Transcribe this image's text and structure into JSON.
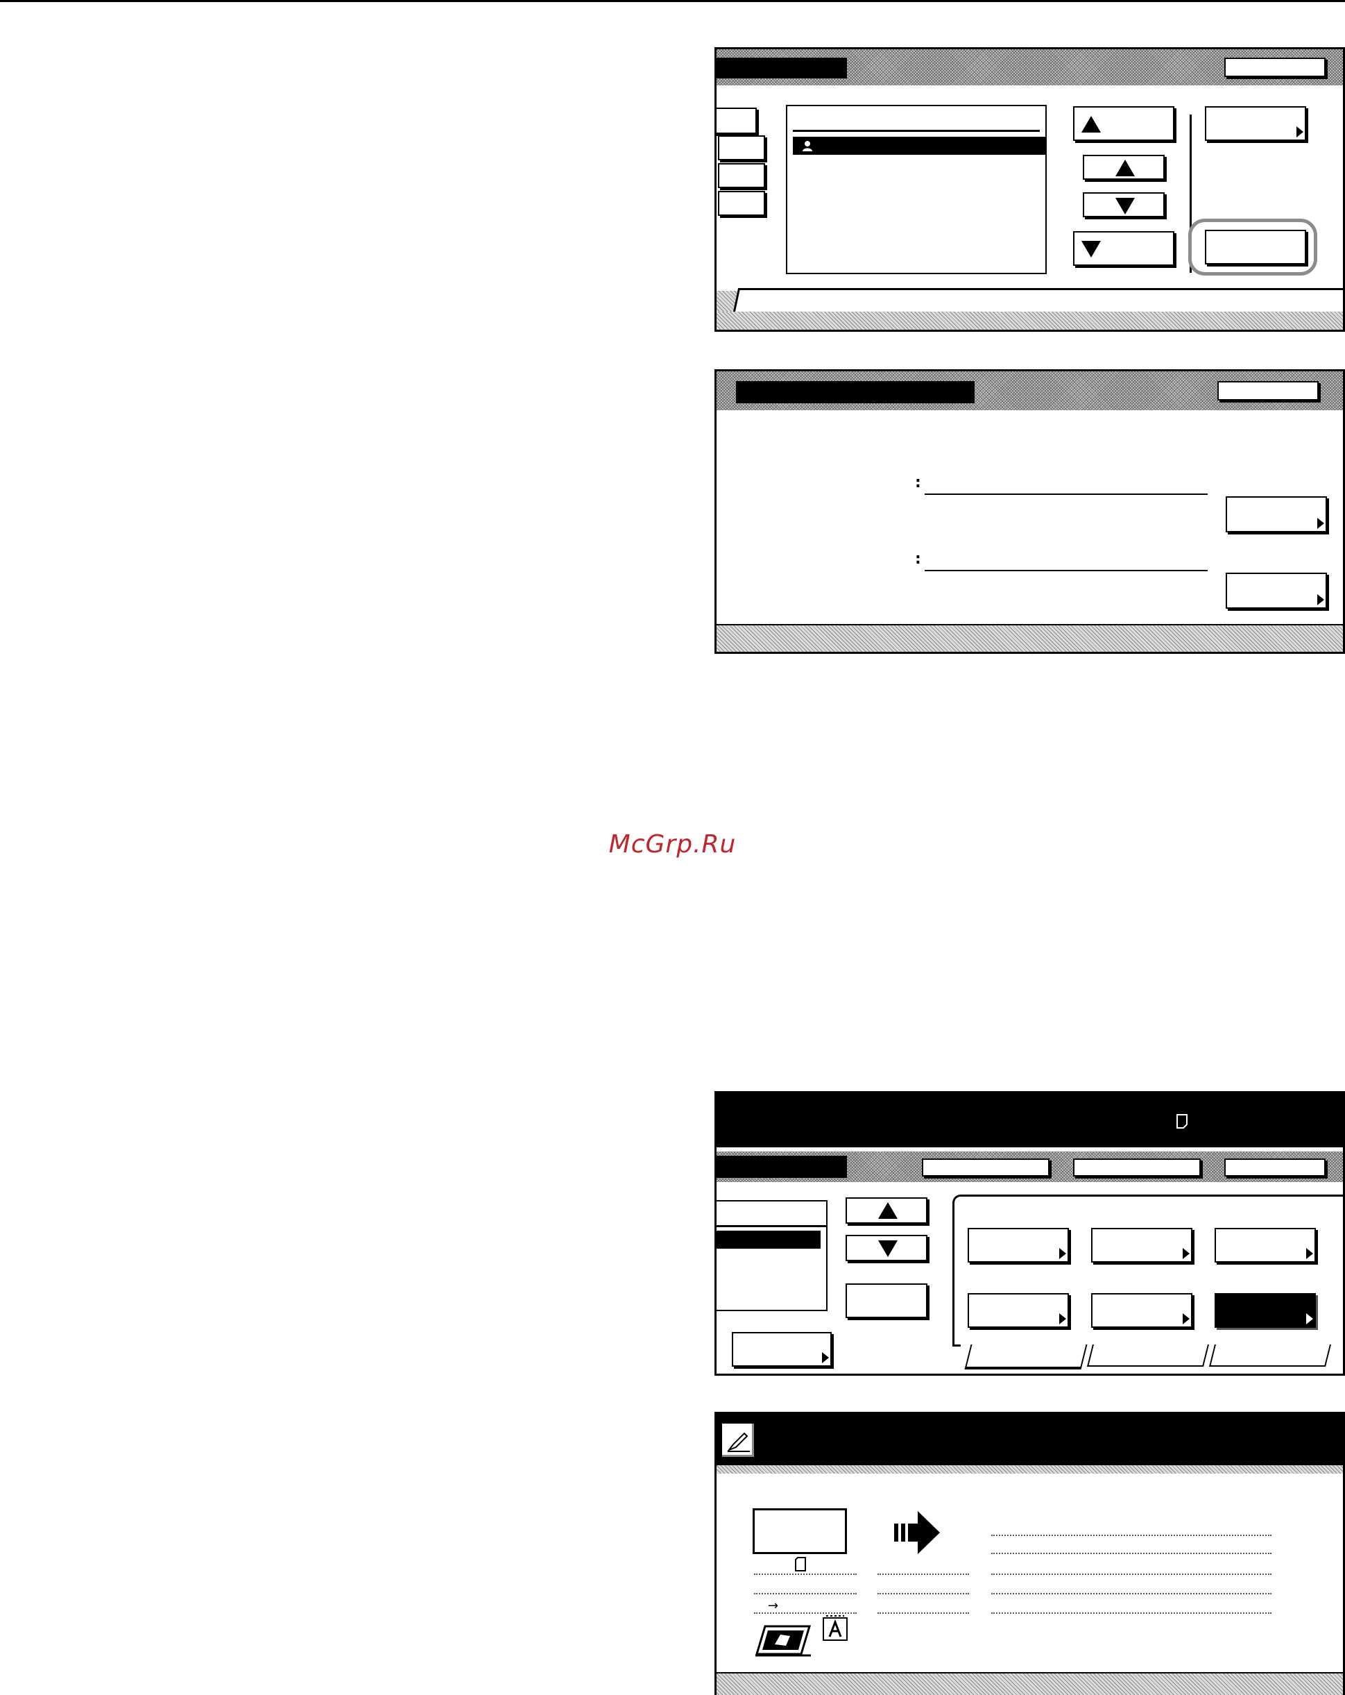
{
  "watermark": {
    "text": "McGrp.Ru",
    "color": "#c0262d"
  },
  "panel3": {
    "status_icon": "paper-portrait-icon"
  },
  "panel4": {
    "header_icon": "pencil-icon",
    "arrow_icon": "right-arrow-icon",
    "arrow_glyph": "→",
    "sheet_icon": "document-letter-a-icon",
    "scan_icon": "scanner-hand-icon"
  }
}
